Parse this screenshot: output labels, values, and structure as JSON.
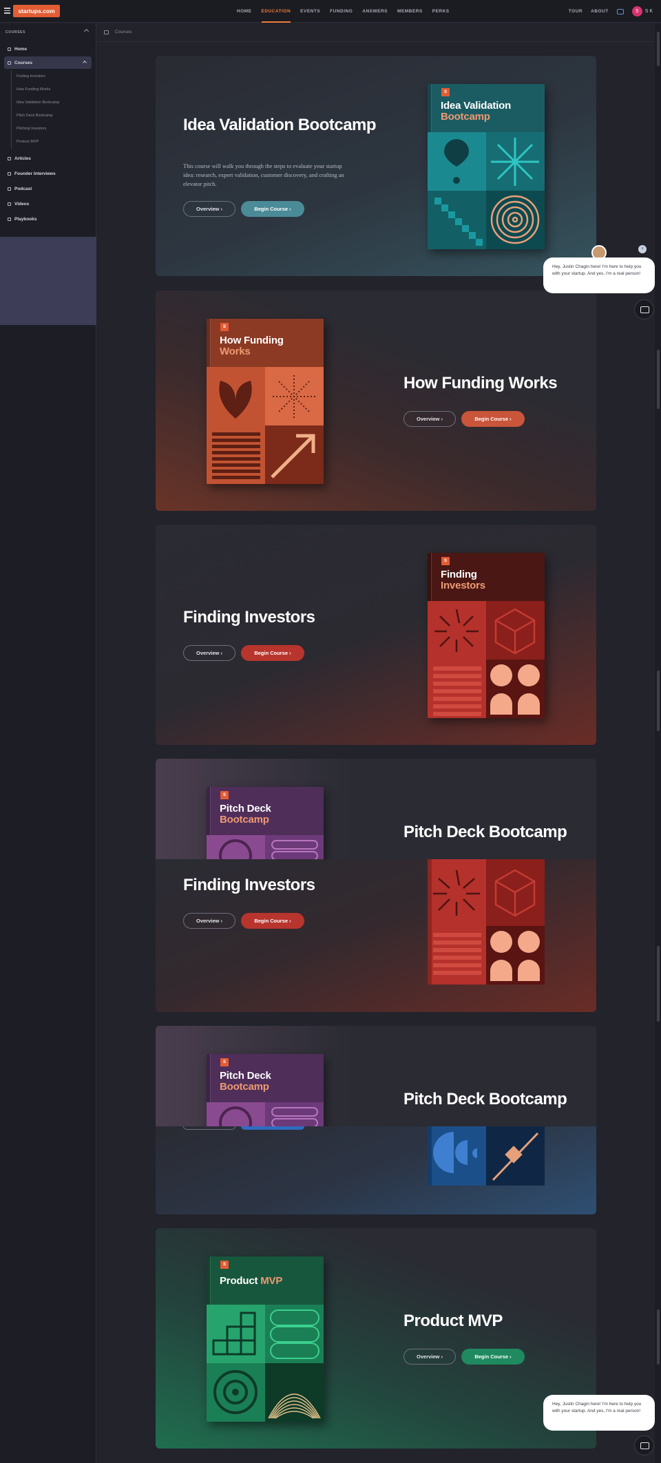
{
  "topnav": {
    "logo": "startups.com",
    "links": [
      "HOME",
      "EDUCATION",
      "EVENTS",
      "FUNDING",
      "ANSWERS",
      "MEMBERS",
      "PERKS"
    ],
    "right_links": [
      "TOUR",
      "ABOUT"
    ],
    "avatar_letter": "S",
    "user_initials": "S K",
    "accent": "#ef7b3b"
  },
  "sidebar": {
    "header": "COURSES",
    "home": "Home",
    "courses": "Courses",
    "course_items": [
      "Finding Investors",
      "How Funding Works",
      "Idea Validation Bootcamp",
      "Pitch Deck Bootcamp",
      "Pitching Investors",
      "Product MVP"
    ],
    "other_items": [
      "Articles",
      "Founder Interviews",
      "Podcast",
      "Videos",
      "Playbooks"
    ]
  },
  "breadcrumb": "Courses",
  "cards": {
    "c1": {
      "title": "Idea Validation Bootcamp",
      "description": "This course will walk you through the steps to evaluate your startup idea: research, expert validation, customer discovery, and crafting an elevator pitch.",
      "book_line1": "Idea Validation",
      "book_line2": "Bootcamp",
      "overview": "Overview",
      "begin": "Begin Course",
      "accent": "#4b8b98"
    },
    "c2": {
      "title": "How Funding Works",
      "book_line1": "How Funding",
      "book_line2": "Works",
      "overview": "Overview",
      "begin": "Begin Course",
      "accent": "#c9553a"
    },
    "c3": {
      "title": "Finding Investors",
      "book_line1": "Finding",
      "book_line2": "Investors",
      "overview": "Overview",
      "begin": "Begin Course",
      "accent": "#b8352e"
    },
    "c4": {
      "title": "Pitch Deck Bootcamp",
      "book_line1": "Pitch Deck",
      "book_line2": "Bootcamp"
    },
    "c5": {
      "title": "Finding Investors",
      "overview": "Overview",
      "begin": "Begin Course"
    },
    "c6": {
      "title": "Pitch Deck Bootcamp",
      "book_line1": "Pitch Deck",
      "book_line2": "Bootcamp"
    },
    "c7": {
      "title": "Product MVP",
      "book_line1": "Product",
      "book_line2": "MVP",
      "overview": "Overview",
      "begin": "Begin Course",
      "accent": "#1f8a5f"
    }
  },
  "chat": {
    "message": "Hey, Justin Chagin here! I'm here to help you with your startup. And yes, I'm a real person!",
    "close": "×"
  },
  "book_badge": "S"
}
